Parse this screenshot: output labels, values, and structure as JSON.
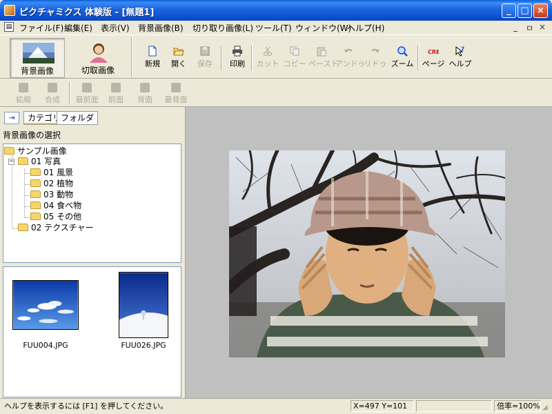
{
  "window": {
    "title": "ピクチャミクス 体験版 - [無題1]",
    "buttons": {
      "minimize": "_",
      "maximize": "□",
      "close": "×"
    }
  },
  "menu": {
    "items": [
      "ファイル(F)",
      "編集(E)",
      "表示(V)",
      "背景画像(B)",
      "切り取り画像(L)",
      "ツール(T)",
      "ウィンドウ(W)",
      "ヘルプ(H)"
    ],
    "mdi_controls": [
      "_",
      "ㅁ",
      "×"
    ]
  },
  "modes": [
    {
      "label": "背景画像",
      "active": true
    },
    {
      "label": "切取画像",
      "active": false
    }
  ],
  "toolbar": [
    {
      "label": "新規",
      "icon": "new-document-icon",
      "enabled": true
    },
    {
      "label": "開く",
      "icon": "open-folder-icon",
      "enabled": true
    },
    {
      "label": "保存",
      "icon": "save-disk-icon",
      "enabled": false
    },
    {
      "label": "印刷",
      "icon": "printer-icon",
      "enabled": true
    },
    {
      "label": "カット",
      "icon": "scissors-icon",
      "enabled": false
    },
    {
      "label": "コピー",
      "icon": "copy-icon",
      "enabled": false
    },
    {
      "label": "ペースト",
      "icon": "paste-icon",
      "enabled": false
    },
    {
      "label": "アンドゥ",
      "icon": "undo-icon",
      "enabled": false
    },
    {
      "label": "リドゥ",
      "icon": "redo-icon",
      "enabled": false
    },
    {
      "label": "ズーム",
      "icon": "zoom-icon",
      "enabled": true
    },
    {
      "label": "ページ",
      "icon": "creo-page-icon",
      "enabled": true
    },
    {
      "label": "ヘルプ",
      "icon": "help-pointer-icon",
      "enabled": true
    }
  ],
  "toolbar2": [
    {
      "label": "拡縮",
      "icon": "scale-icon",
      "enabled": false
    },
    {
      "label": "合成",
      "icon": "composite-icon",
      "enabled": false
    },
    {
      "label": "最前面",
      "icon": "bring-front-icon",
      "enabled": false
    },
    {
      "label": "前面",
      "icon": "bring-forward-icon",
      "enabled": false
    },
    {
      "label": "背面",
      "icon": "send-backward-icon",
      "enabled": false
    },
    {
      "label": "最背面",
      "icon": "send-back-icon",
      "enabled": false
    }
  ],
  "panel": {
    "toggle_icon": "⇥",
    "tabs": [
      {
        "label": "カテゴリ",
        "active": true
      },
      {
        "label": "フォルダ",
        "active": false
      }
    ],
    "heading": "背景画像の選択",
    "tree": {
      "root": "サンプル画像",
      "nodes": [
        {
          "label": "01 写真",
          "level": 1,
          "expander": "−"
        },
        {
          "label": "01 風景",
          "level": 2
        },
        {
          "label": "02 植物",
          "level": 2
        },
        {
          "label": "03 動物",
          "level": 2
        },
        {
          "label": "04 食べ物",
          "level": 2
        },
        {
          "label": "05 その他",
          "level": 2
        },
        {
          "label": "02 テクスチャー",
          "level": 1
        }
      ]
    },
    "thumbnails": [
      {
        "filename": "FUU004.JPG"
      },
      {
        "filename": "FUU026.JPG"
      }
    ]
  },
  "status": {
    "help_text": "ヘルプを表示するには [F1] を押してください。",
    "coords": "X=497 Y=101",
    "blank": "",
    "zoom": "倍率=100%"
  },
  "colors": {
    "titlebar": "#0a5fd8",
    "chrome": "#ece9d8",
    "canvas_bg": "#c0c0c0",
    "panel_border": "#7f9db9"
  }
}
